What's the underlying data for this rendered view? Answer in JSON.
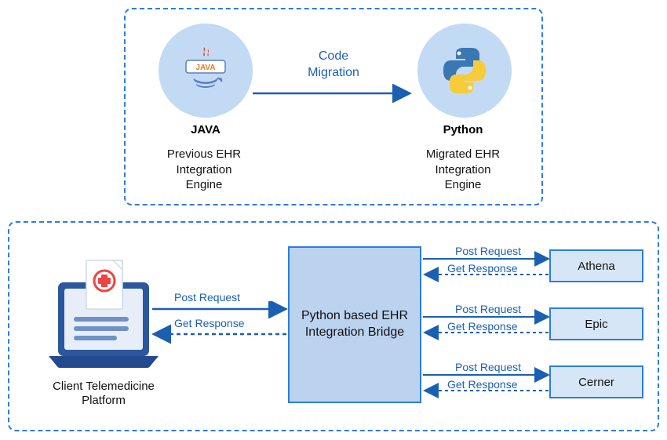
{
  "top": {
    "java": {
      "lang": "JAVA",
      "caption": "Previous EHR Integration Engine"
    },
    "python": {
      "lang": "Python",
      "caption": "Migrated EHR Integration Engine"
    },
    "arrow": "Code\nMigration"
  },
  "bottom": {
    "client_caption": "Client Telemedicine Platform",
    "bridge_caption": "Python based EHR Integration Bridge",
    "post": "Post Request",
    "get": "Get Response",
    "ehrs": {
      "athena": "Athena",
      "epic": "Epic",
      "cerner": "Cerner"
    }
  }
}
